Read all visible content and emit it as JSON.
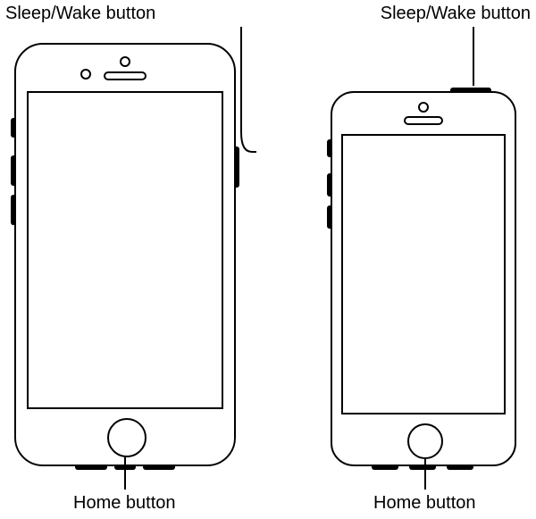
{
  "labels": {
    "left_top": "Sleep/Wake button",
    "right_top": "Sleep/Wake button",
    "left_bottom": "Home button",
    "right_bottom": "Home button"
  },
  "devices": [
    {
      "name": "iphone-left",
      "sleep_wake_location": "right-side",
      "home_button": true
    },
    {
      "name": "iphone-right",
      "sleep_wake_location": "top-edge",
      "home_button": true
    }
  ]
}
